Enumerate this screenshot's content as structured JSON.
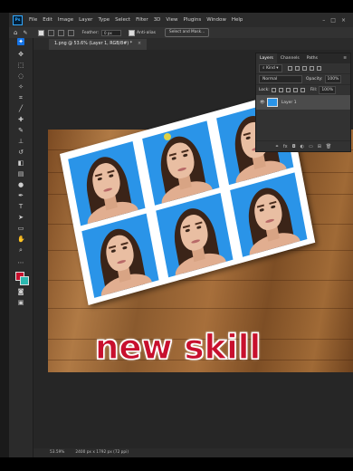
{
  "menubar": {
    "logo": "Ps",
    "items": [
      "File",
      "Edit",
      "Image",
      "Layer",
      "Type",
      "Select",
      "Filter",
      "3D",
      "View",
      "Plugins",
      "Window",
      "Help"
    ]
  },
  "options": {
    "feather_label": "Feather:",
    "feather_value": "0 px",
    "antialias_label": "Anti-alias",
    "select_mask_label": "Select and Mask..."
  },
  "tab": {
    "title": "1.png @ 53.6% (Layer 1, RGB/8#) *",
    "close": "×"
  },
  "layers": {
    "tabs": [
      "Layers",
      "Channels",
      "Paths"
    ],
    "kind_label": "Kind",
    "blend_mode": "Normal",
    "opacity_label": "Opacity:",
    "opacity_value": "100%",
    "lock_label": "Lock:",
    "fill_label": "Fill:",
    "fill_value": "100%",
    "layer_name": "Layer 1"
  },
  "overlay_text": "new skill",
  "status": {
    "zoom": "53.59%",
    "dimensions": "2400 px x 1792 px (72 ppi)"
  },
  "colors": {
    "photo_bg": "#2a94e8",
    "overlay_text": "#c8102e",
    "active_tool": "#1473e6"
  }
}
